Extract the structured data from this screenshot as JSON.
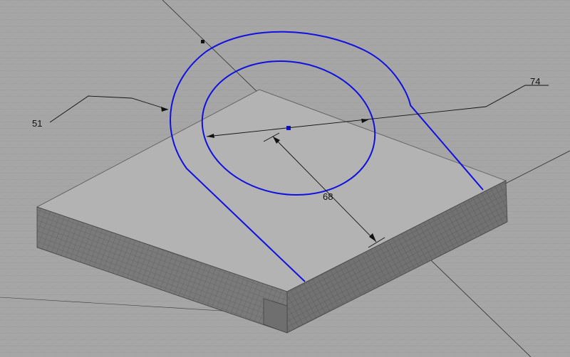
{
  "view": {
    "background": "#a6a6a6",
    "grid_color": "#9b9b9b",
    "face_top_color": "#b4b4b4",
    "face_front_color": "#8a8a8a",
    "face_side_color": "#7f7f7f",
    "sketch_color": "#1010e0"
  },
  "dimensions": {
    "outer_radius_label": "51",
    "inner_diameter_label": "74",
    "height_label": "68"
  }
}
